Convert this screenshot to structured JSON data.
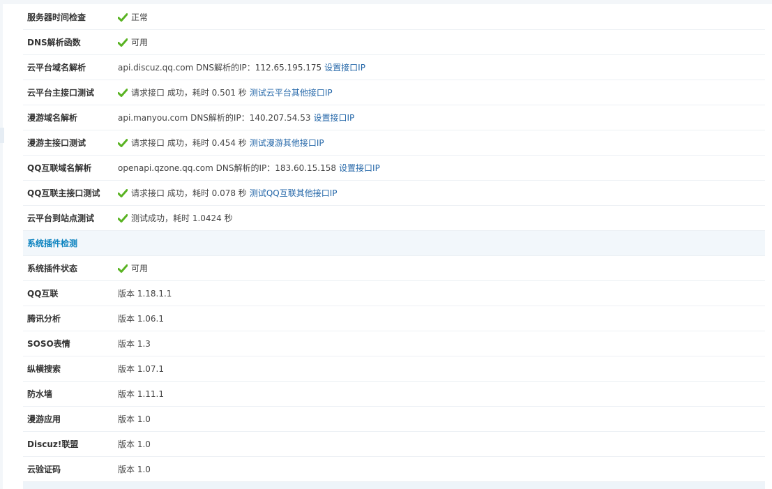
{
  "colors": {
    "check": "#59b322",
    "link": "#2366a8",
    "section_title": "#0a82bf",
    "section_bg": "#f2f7fb"
  },
  "rows": [
    {
      "label": "服务器时间检查",
      "status": "正常"
    },
    {
      "label": "DNS解析函数",
      "status": "可用"
    },
    {
      "label": "云平台域名解析",
      "text": "api.discuz.qq.com DNS解析的IP：112.65.195.175",
      "link": "设置接口IP"
    },
    {
      "label": "云平台主接口测试",
      "status": "请求接口 成功，耗时 0.501 秒",
      "link": "测试云平台其他接口IP"
    },
    {
      "label": "漫游域名解析",
      "text": "api.manyou.com DNS解析的IP：140.207.54.53",
      "link": "设置接口IP"
    },
    {
      "label": "漫游主接口测试",
      "status": "请求接口 成功，耗时 0.454 秒",
      "link": "测试漫游其他接口IP"
    },
    {
      "label": "QQ互联域名解析",
      "text": "openapi.qzone.qq.com DNS解析的IP：183.60.15.158",
      "link": "设置接口IP"
    },
    {
      "label": "QQ互联主接口测试",
      "status": "请求接口 成功，耗时 0.078 秒",
      "link": "测试QQ互联其他接口IP"
    },
    {
      "label": "云平台到站点测试",
      "status": "测试成功，耗时 1.0424 秒"
    }
  ],
  "plugin_section": {
    "title": "系统插件检测",
    "status_row": {
      "label": "系统插件状态",
      "status": "可用"
    },
    "plugins": [
      {
        "label": "QQ互联",
        "version": "版本 1.18.1.1"
      },
      {
        "label": "腾讯分析",
        "version": "版本 1.06.1"
      },
      {
        "label": "SOSO表情",
        "version": "版本 1.3"
      },
      {
        "label": "纵横搜索",
        "version": "版本 1.07.1"
      },
      {
        "label": "防水墙",
        "version": "版本 1.11.1"
      },
      {
        "label": "漫游应用",
        "version": "版本 1.0"
      },
      {
        "label": "Discuz!联盟",
        "version": "版本 1.0"
      },
      {
        "label": "云验证码",
        "version": "版本 1.0"
      }
    ]
  }
}
